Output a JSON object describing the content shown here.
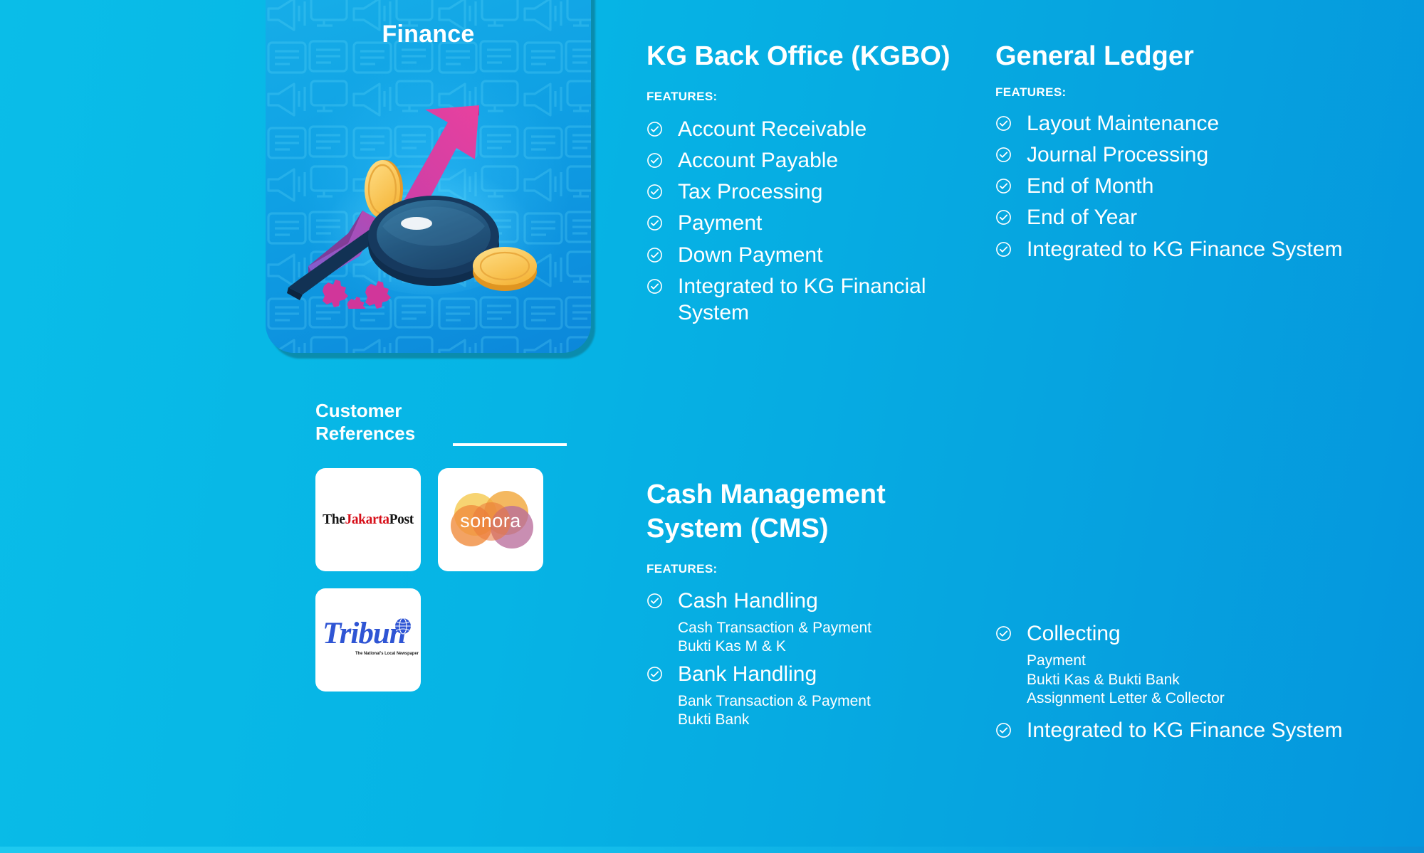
{
  "theme": {
    "background_start": "#0abde8",
    "background_end": "#0596dd",
    "card_accent": "#0fa0e4",
    "text_color": "#ffffff"
  },
  "finance_card": {
    "title": "Finance",
    "illustration_name": "finance-growth-illustration"
  },
  "customer_references": {
    "heading_line1": "Customer",
    "heading_line2": "References",
    "logos": [
      {
        "name": "the-jakarta-post",
        "part1": "The",
        "part2": "Jakarta",
        "part3": "Post"
      },
      {
        "name": "sonora",
        "text": "sonora"
      },
      {
        "name": "tribun",
        "text": "Tribun",
        "tagline": "The National's Local Newspaper"
      }
    ]
  },
  "sections": [
    {
      "id": "kgbo",
      "title": "KG Back Office (KGBO)",
      "features_label": "FEATURES:",
      "features": [
        {
          "text": "Account Receivable"
        },
        {
          "text": "Account Payable"
        },
        {
          "text": "Tax Processing"
        },
        {
          "text": "Payment"
        },
        {
          "text": "Down Payment"
        },
        {
          "text": "Integrated to KG Financial System"
        }
      ]
    },
    {
      "id": "general-ledger",
      "title": "General Ledger",
      "features_label": "FEATURES:",
      "features": [
        {
          "text": "Layout Maintenance"
        },
        {
          "text": "Journal Processing"
        },
        {
          "text": "End of Month"
        },
        {
          "text": "End of Year"
        },
        {
          "text": "Integrated to KG Finance System"
        }
      ]
    },
    {
      "id": "cms",
      "title": "Cash Management System (CMS)",
      "features_label": "FEATURES:",
      "features": [
        {
          "text": "Cash Handling",
          "sub": [
            "Cash Transaction & Payment",
            "Bukti Kas M & K"
          ]
        },
        {
          "text": "Bank Handling",
          "sub": [
            "Bank Transaction & Payment",
            "Bukti Bank"
          ]
        }
      ]
    },
    {
      "id": "collecting",
      "title": "",
      "features": [
        {
          "text": "Collecting",
          "sub": [
            "Payment",
            "Bukti Kas & Bukti Bank",
            "Assignment Letter & Collector"
          ]
        },
        {
          "text": "Integrated to KG Finance System"
        }
      ]
    }
  ]
}
